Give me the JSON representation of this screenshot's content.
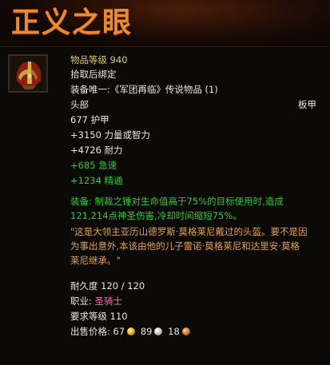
{
  "item": {
    "name": "正义之眼",
    "item_level": "物品等级 940",
    "binding": "拾取后绑定",
    "unique_set": "装备唯一:《军团再临》传说物品 (1)",
    "slot": "头部",
    "armor_type": "板甲",
    "armor": "677 护甲",
    "stat_primary": "+3150 力量或智力",
    "stat_stamina": "+4726 耐力",
    "stat_haste": "+685 急速",
    "stat_mastery": "+1234 精通",
    "equip_line1": "装备: 制裁之锤对生命值高于75%的目标使用时,造成",
    "equip_line2": "121,214点神圣伤害,冷却时间缩短75%。",
    "flavor_line1": "\"这是大领主亚历山德罗斯·莫格莱尼戴过的头盔。要不是因",
    "flavor_line2": "为事出意外,本该由他的儿子雷诺·莫格莱尼和达里安·莫格",
    "flavor_line3": "莱尼继承。\"",
    "durability": "耐久度 120 / 120",
    "class_label": "职业:",
    "class_value": "圣骑士",
    "required_level": "要求等级 110",
    "sell_label": "出售价格:",
    "sell_gold": "67",
    "sell_silver": "89",
    "sell_copper": "18",
    "icon": "helmet-icon"
  },
  "colors": {
    "title": "#e98b34",
    "yellow": "#d8c96a",
    "green": "#37c33a",
    "orange": "#e0a24b",
    "class": "#f06ab3"
  }
}
